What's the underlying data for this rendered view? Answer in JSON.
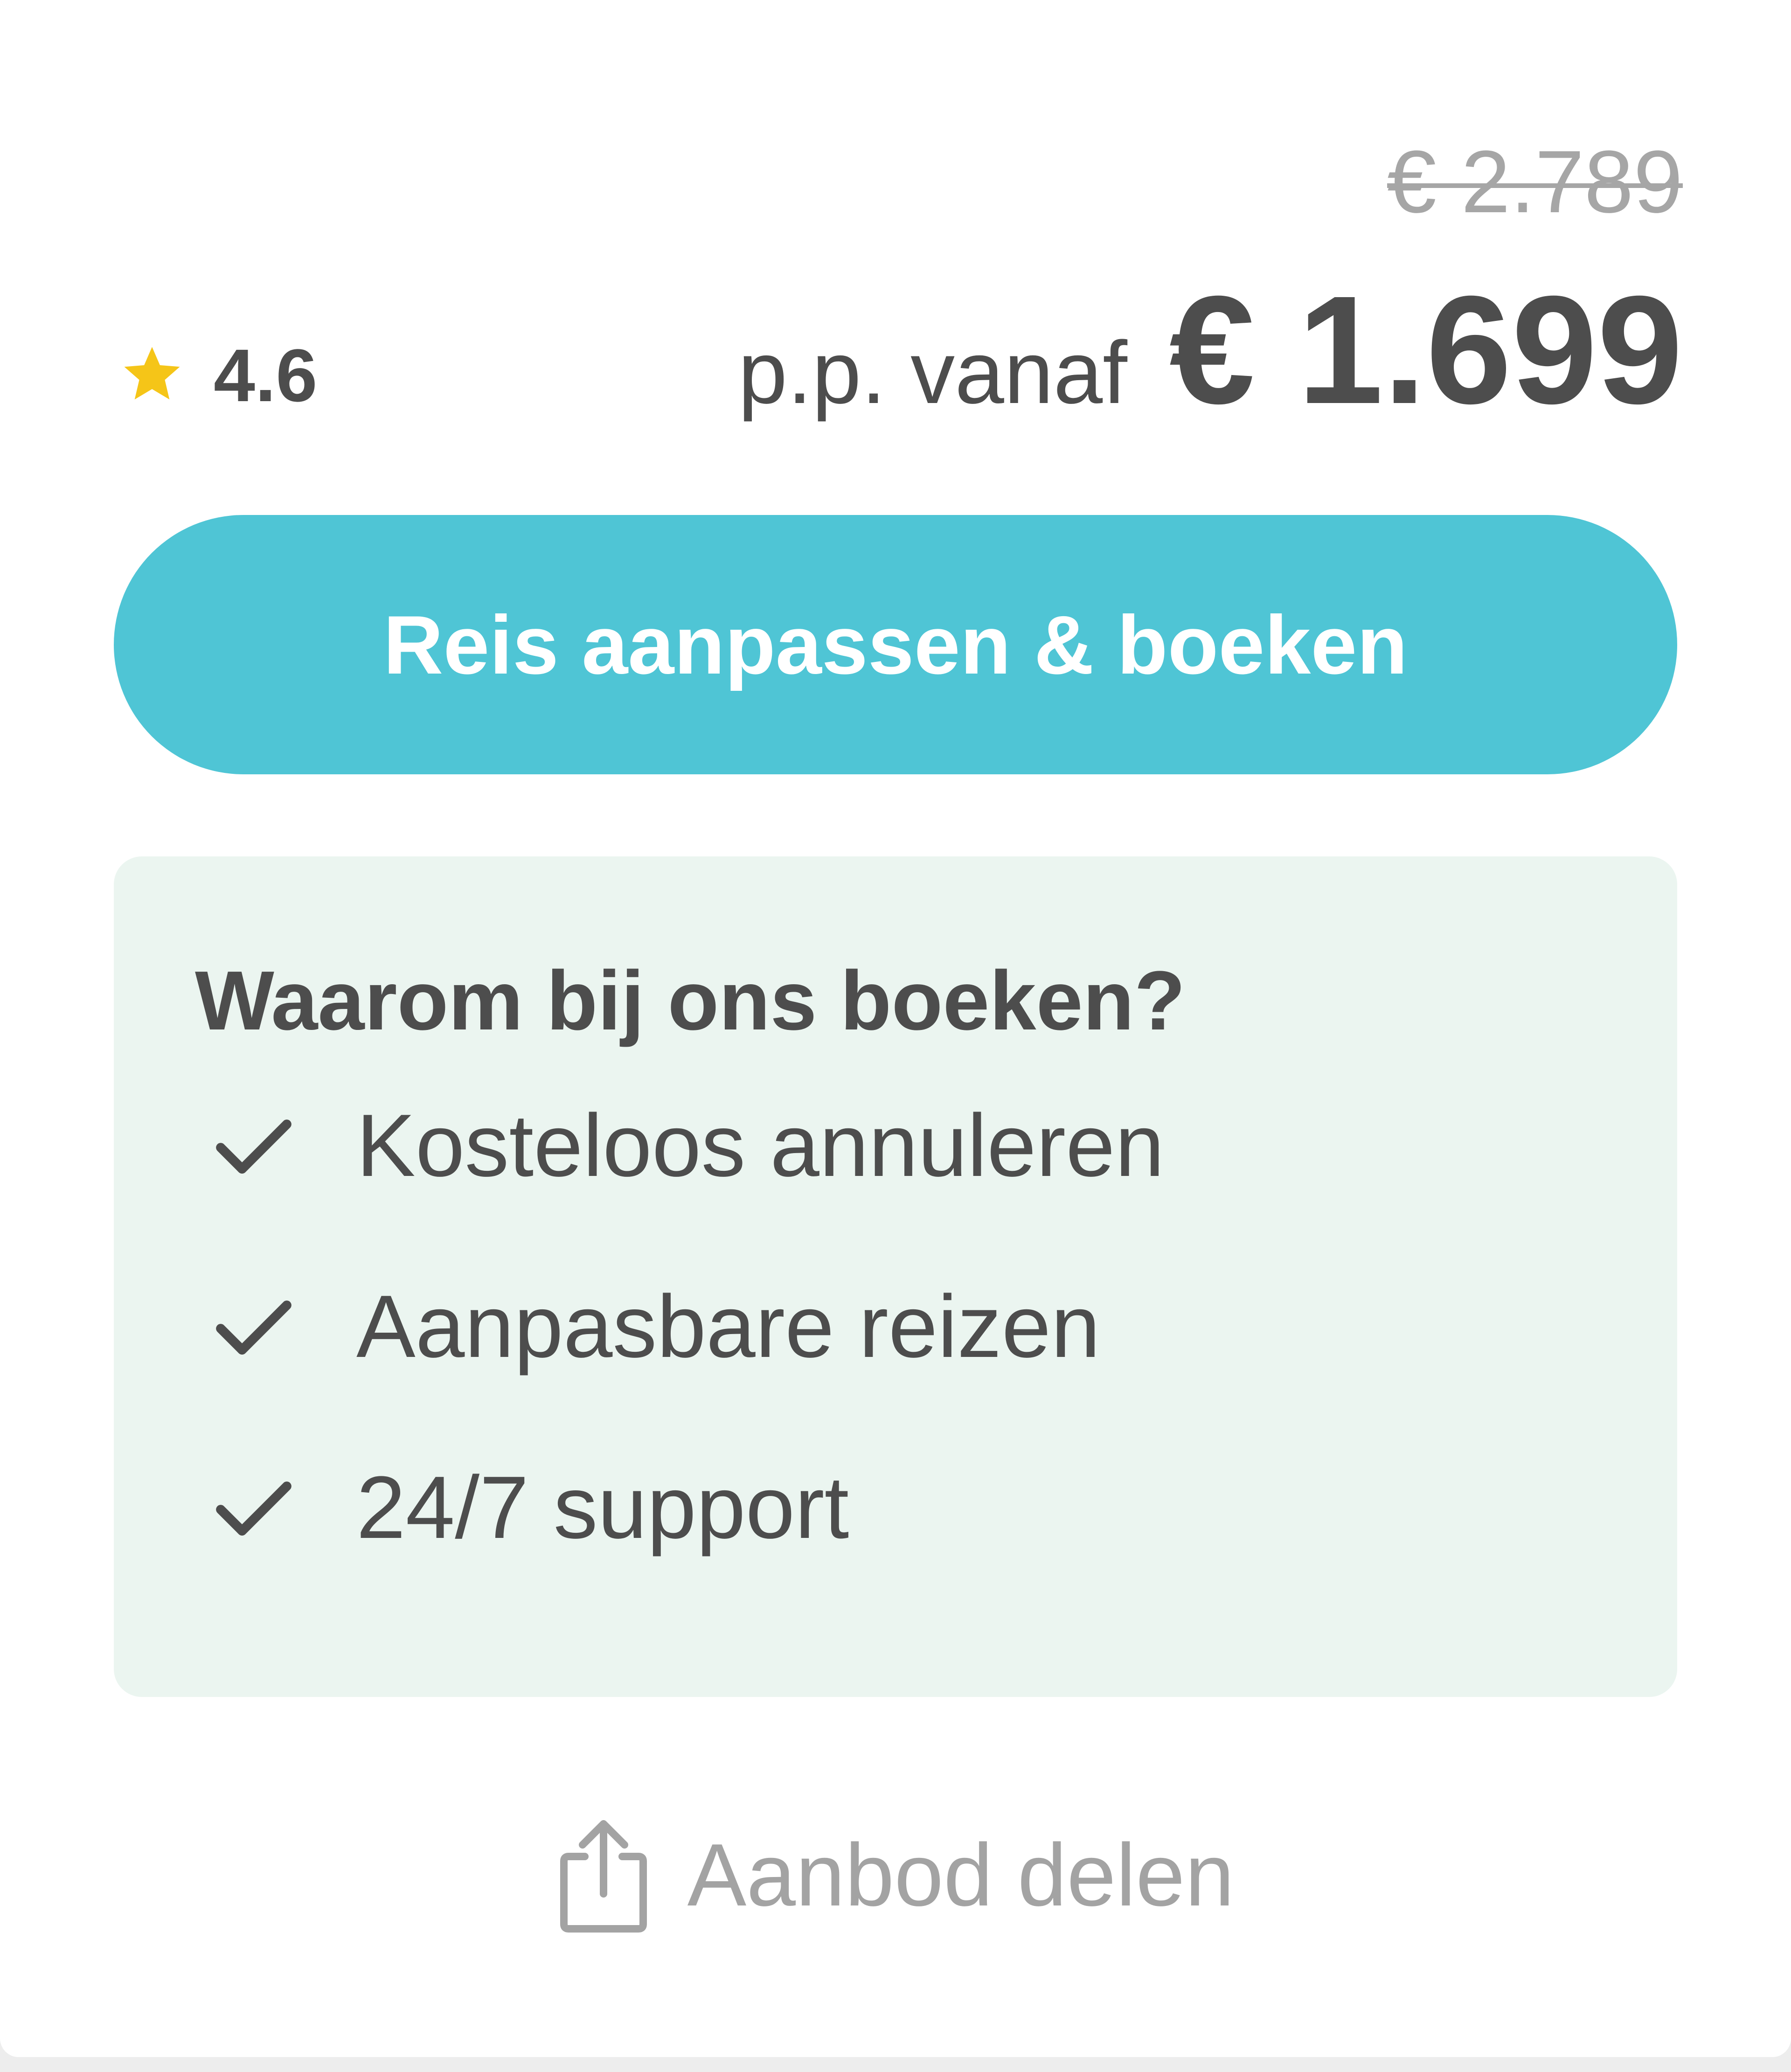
{
  "pricing": {
    "old_price": "€ 2.789",
    "prefix": "p.p. vanaf",
    "current_price": "€ 1.699"
  },
  "rating": {
    "value": "4.6",
    "icon": "star-icon",
    "icon_color": "#f5c518"
  },
  "cta": {
    "label": "Reis aanpassen & boeken",
    "color": "#4fc5d5"
  },
  "benefits": {
    "title": "Waarom bij ons boeken?",
    "background": "#ebf5f0",
    "items": [
      {
        "icon": "check-icon",
        "label": "Kosteloos annuleren"
      },
      {
        "icon": "check-icon",
        "label": "Aanpasbare reizen"
      },
      {
        "icon": "check-icon",
        "label": "24/7 support"
      }
    ]
  },
  "share": {
    "icon": "share-icon",
    "label": "Aanbod delen"
  }
}
